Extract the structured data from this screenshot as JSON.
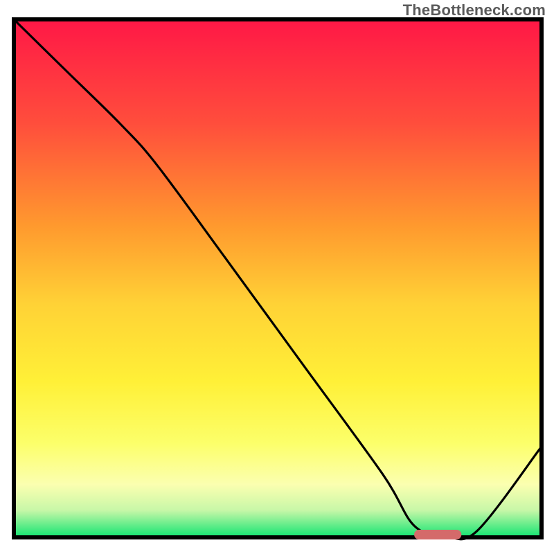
{
  "watermark": "TheBottleneck.com",
  "chart_data": {
    "type": "line",
    "title": "",
    "xlabel": "",
    "ylabel": "",
    "xlim": [
      0,
      100
    ],
    "ylim": [
      0,
      100
    ],
    "grid": false,
    "legend": false,
    "series": [
      {
        "name": "bottleneck-curve",
        "x": [
          0,
          10,
          20,
          27,
          40,
          55,
          70,
          76,
          82,
          88,
          100
        ],
        "y": [
          100,
          90,
          80,
          72,
          54,
          33,
          12,
          2,
          0,
          1,
          17
        ],
        "color": "#000000"
      }
    ],
    "marker": {
      "name": "optimal-segment",
      "x_start": 76,
      "x_end": 85,
      "y": 0,
      "color": "#d46a6a"
    },
    "background_gradient": {
      "stops": [
        {
          "offset": 0.0,
          "color": "#ff1846"
        },
        {
          "offset": 0.2,
          "color": "#ff4e3c"
        },
        {
          "offset": 0.4,
          "color": "#ff9a2e"
        },
        {
          "offset": 0.55,
          "color": "#ffd236"
        },
        {
          "offset": 0.7,
          "color": "#fff037"
        },
        {
          "offset": 0.82,
          "color": "#fcff6a"
        },
        {
          "offset": 0.9,
          "color": "#fbffb0"
        },
        {
          "offset": 0.95,
          "color": "#c8f7a8"
        },
        {
          "offset": 1.0,
          "color": "#19e574"
        }
      ]
    },
    "axis_color": "#000000"
  }
}
